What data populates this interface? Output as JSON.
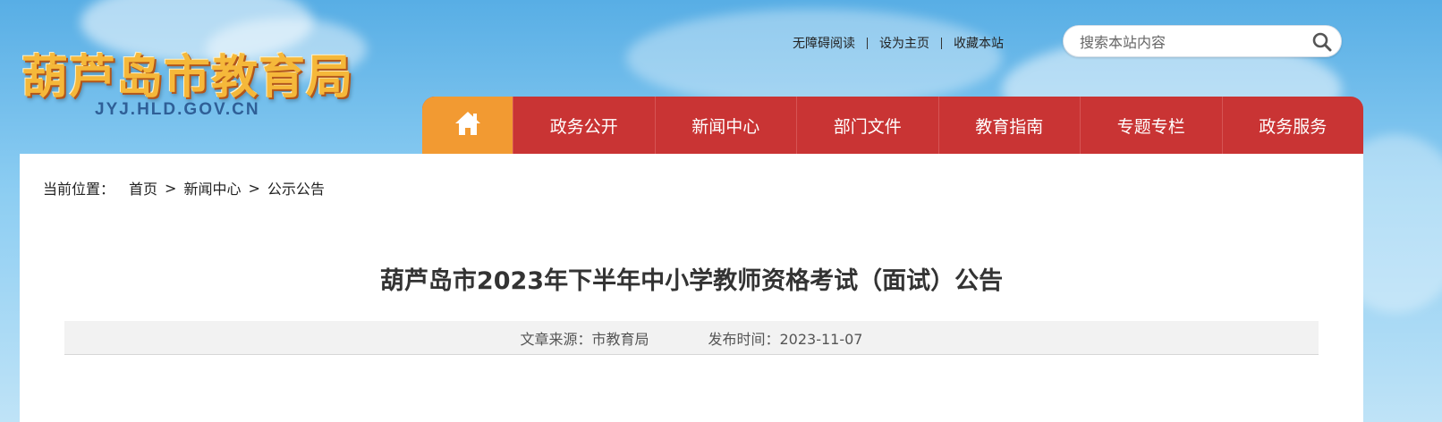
{
  "site": {
    "title": "葫芦岛市教育局",
    "domain": "JYJ.HLD.GOV.CN"
  },
  "top_links": [
    "无障碍阅读",
    "设为主页",
    "收藏本站"
  ],
  "search": {
    "placeholder": "搜索本站内容",
    "value": "",
    "icon": "search-icon"
  },
  "nav": {
    "home_icon": "home-icon",
    "items": [
      "政务公开",
      "新闻中心",
      "部门文件",
      "教育指南",
      "专题专栏",
      "政务服务"
    ]
  },
  "breadcrumb": {
    "prefix": "当前位置：",
    "items": [
      "首页",
      "新闻中心",
      "公示公告"
    ],
    "separator": ">"
  },
  "article": {
    "title": "葫芦岛市2023年下半年中小学教师资格考试（面试）公告",
    "source": "文章来源：市教育局",
    "date": "发布时间：2023-11-07"
  },
  "colors": {
    "nav_red": "#c93434",
    "nav_home_orange": "#f29a32",
    "logo_gold": "#f5b83a",
    "domain_blue": "#2f5f97"
  }
}
